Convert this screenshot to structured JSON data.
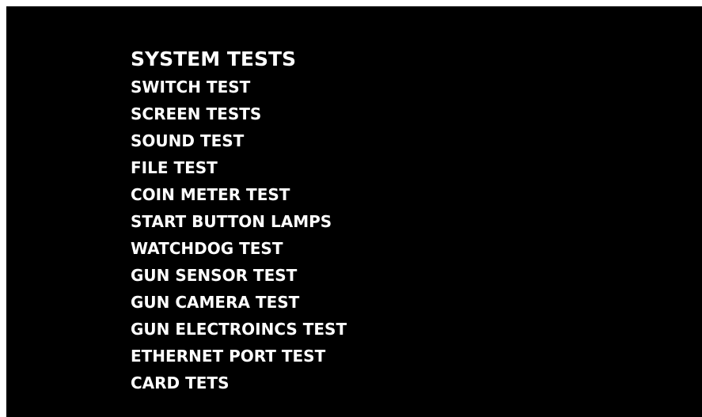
{
  "screen": {
    "background_color": "#000000",
    "text_color": "#ffffff"
  },
  "menu": {
    "title": "SYSTEM TESTS",
    "items": [
      {
        "label": "SWITCH TEST"
      },
      {
        "label": "SCREEN TESTS"
      },
      {
        "label": "SOUND TEST"
      },
      {
        "label": "FILE TEST"
      },
      {
        "label": "COIN METER TEST"
      },
      {
        "label": "START BUTTON LAMPS"
      },
      {
        "label": "WATCHDOG TEST"
      },
      {
        "label": "GUN SENSOR TEST"
      },
      {
        "label": "GUN CAMERA TEST"
      },
      {
        "label": "GUN ELECTROINCS TEST"
      },
      {
        "label": "ETHERNET PORT TEST"
      },
      {
        "label": "CARD TETS"
      }
    ]
  }
}
